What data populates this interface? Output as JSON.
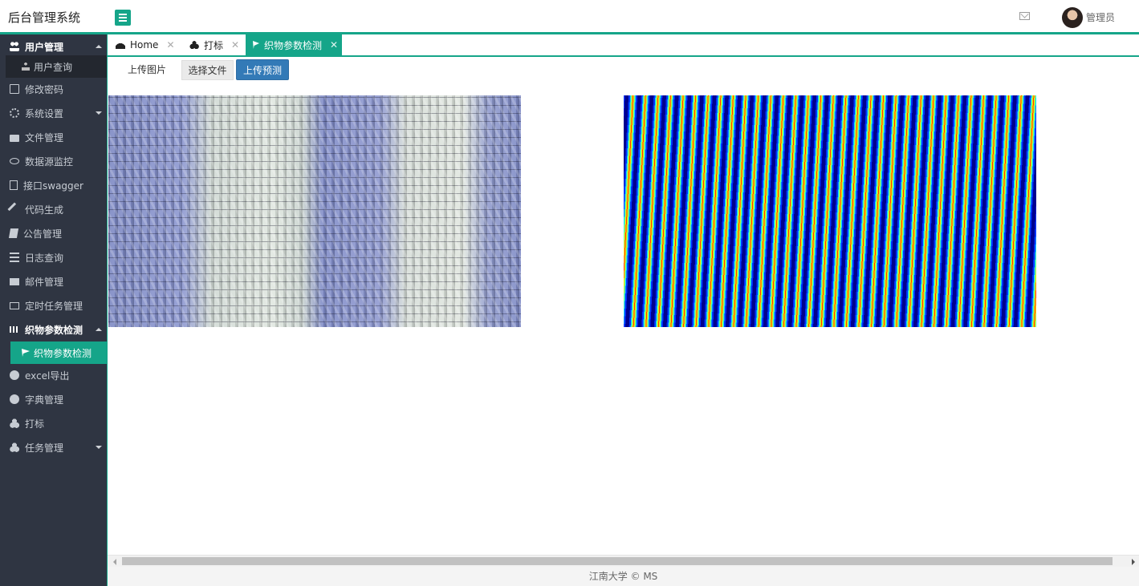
{
  "app": {
    "title": "后台管理系统"
  },
  "header": {
    "username": "管理员"
  },
  "sidebar": {
    "items": [
      {
        "label": "用户管理",
        "icon": "users-icon",
        "expanded": true
      },
      {
        "label": "用户查询",
        "icon": "user-icon",
        "sub": true
      },
      {
        "label": "修改密码",
        "icon": "edit-icon"
      },
      {
        "label": "系统设置",
        "icon": "cogs-icon",
        "has_children": true
      },
      {
        "label": "文件管理",
        "icon": "folder-icon"
      },
      {
        "label": "数据源监控",
        "icon": "eye-icon"
      },
      {
        "label": "接口swagger",
        "icon": "file-pdf-icon"
      },
      {
        "label": "代码生成",
        "icon": "wrench-icon"
      },
      {
        "label": "公告管理",
        "icon": "book-icon"
      },
      {
        "label": "日志查询",
        "icon": "bars-icon"
      },
      {
        "label": "邮件管理",
        "icon": "envelope-icon"
      },
      {
        "label": "定时任务管理",
        "icon": "credit-card-icon"
      },
      {
        "label": "织物参数检测",
        "icon": "fabric-icon",
        "expanded": true
      },
      {
        "label": "织物参数检测",
        "icon": "flag-icon",
        "sub": true,
        "selected": true
      },
      {
        "label": "excel导出",
        "icon": "download-icon"
      },
      {
        "label": "字典管理",
        "icon": "smile-icon"
      },
      {
        "label": "打标",
        "icon": "cubes-icon"
      },
      {
        "label": "任务管理",
        "icon": "cubes-icon",
        "has_children": true
      }
    ]
  },
  "tabs": [
    {
      "label": "Home",
      "icon": "dashboard-icon",
      "active": false
    },
    {
      "label": "打标",
      "icon": "cubes-icon",
      "active": false
    },
    {
      "label": "织物参数检测",
      "icon": "flag-icon",
      "active": true
    }
  ],
  "tab_close": "✕",
  "main": {
    "upload_label": "上传图片",
    "choose_file_label": "选择文件",
    "predict_label": "上传预测"
  },
  "footer": {
    "text": "江南大学 © MS"
  },
  "colors": {
    "accent": "#15a589",
    "sidebar_bg": "#2f3542",
    "primary_button": "#337ab7"
  }
}
